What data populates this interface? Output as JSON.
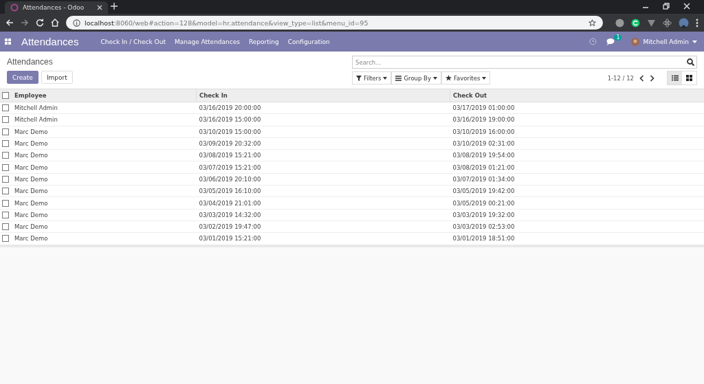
{
  "browser": {
    "tab_title": "Attendances - Odoo",
    "url_host": "localhost",
    "url_path": ":8060/web#action=128&model=hr.attendance&view_type=list&menu_id=95"
  },
  "navbar": {
    "app": "Attendances",
    "menus": [
      "Check In / Check Out",
      "Manage Attendances",
      "Reporting",
      "Configuration"
    ],
    "messages_badge": "1",
    "user": "Mitchell Admin"
  },
  "control_panel": {
    "breadcrumb": "Attendances",
    "buttons": [
      {
        "label": "Create",
        "kind": "primary"
      },
      {
        "label": "Import",
        "kind": "secondary"
      }
    ],
    "search": {
      "placeholder": "Search..."
    },
    "filters": [
      {
        "label": "Filters",
        "kind": "filter"
      },
      {
        "label": "Group By",
        "kind": "group"
      },
      {
        "label": "Favorites",
        "kind": "star"
      }
    ],
    "pager": "1-12 / 12",
    "views": [
      {
        "kind": "list",
        "selected": true
      },
      {
        "kind": "kanban",
        "selected": false
      }
    ]
  },
  "table": {
    "all_checked": false,
    "columns": [
      "Employee",
      "Check In",
      "Check Out"
    ],
    "rows": [
      {
        "checked": false,
        "cells": [
          "Mitchell Admin",
          "03/16/2019 20:00:00",
          "03/17/2019 01:00:00"
        ]
      },
      {
        "checked": false,
        "cells": [
          "Mitchell Admin",
          "03/16/2019 15:00:00",
          "03/16/2019 19:00:00"
        ]
      },
      {
        "checked": false,
        "cells": [
          "Marc Demo",
          "03/10/2019 15:00:00",
          "03/10/2019 16:00:00"
        ]
      },
      {
        "checked": false,
        "cells": [
          "Marc Demo",
          "03/09/2019 20:32:00",
          "03/10/2019 02:31:00"
        ]
      },
      {
        "checked": false,
        "cells": [
          "Marc Demo",
          "03/08/2019 15:21:00",
          "03/08/2019 19:54:00"
        ]
      },
      {
        "checked": false,
        "cells": [
          "Marc Demo",
          "03/07/2019 15:21:00",
          "03/08/2019 01:21:00"
        ]
      },
      {
        "checked": false,
        "cells": [
          "Marc Demo",
          "03/06/2019 20:10:00",
          "03/07/2019 01:34:00"
        ]
      },
      {
        "checked": false,
        "cells": [
          "Marc Demo",
          "03/05/2019 16:10:00",
          "03/05/2019 19:42:00"
        ]
      },
      {
        "checked": false,
        "cells": [
          "Marc Demo",
          "03/04/2019 21:01:00",
          "03/05/2019 00:21:00"
        ]
      },
      {
        "checked": false,
        "cells": [
          "Marc Demo",
          "03/03/2019 14:32:00",
          "03/03/2019 19:32:00"
        ]
      },
      {
        "checked": false,
        "cells": [
          "Marc Demo",
          "03/02/2019 19:47:00",
          "03/03/2019 02:53:00"
        ]
      },
      {
        "checked": false,
        "cells": [
          "Marc Demo",
          "03/01/2019 15:21:00",
          "03/01/2019 18:51:00"
        ]
      }
    ]
  }
}
